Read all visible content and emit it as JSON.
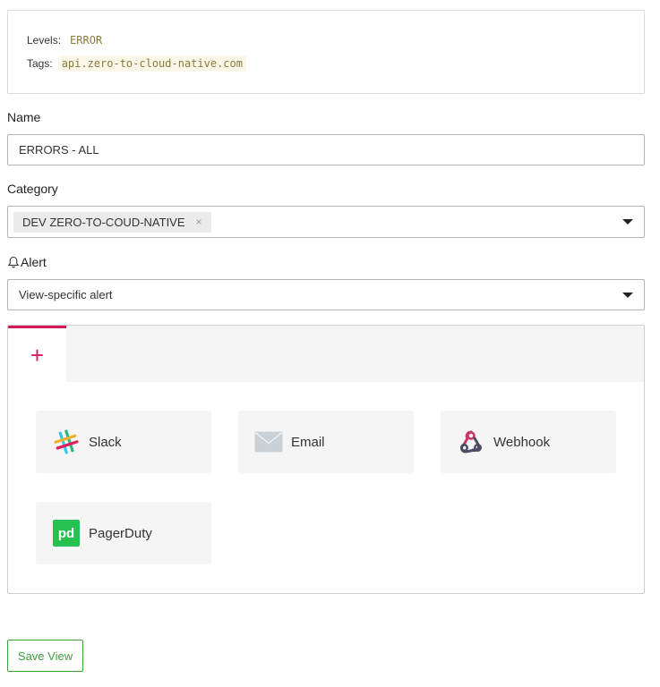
{
  "summary": {
    "levels_label": "Levels:",
    "levels_value": "ERROR",
    "tags_label": "Tags:",
    "tags_value": "api.zero-to-cloud-native.com"
  },
  "name_field": {
    "label": "Name",
    "value": "ERRORS - ALL"
  },
  "category_field": {
    "label": "Category",
    "selected_tag": "DEV ZERO-TO-COUD-NATIVE",
    "remove_glyph": "×"
  },
  "alert_field": {
    "label": "Alert",
    "value": "View-specific alert"
  },
  "alert_panel": {
    "add_tab_glyph": "+",
    "accent_color": "#d6185b",
    "integrations": [
      {
        "label": "Slack",
        "icon": "slack-icon"
      },
      {
        "label": "Email",
        "icon": "email-icon"
      },
      {
        "label": "Webhook",
        "icon": "webhook-icon"
      },
      {
        "label": "PagerDuty",
        "icon": "pagerduty-icon"
      }
    ]
  },
  "actions": {
    "save_label": "Save View",
    "save_color": "#3aa33a"
  }
}
